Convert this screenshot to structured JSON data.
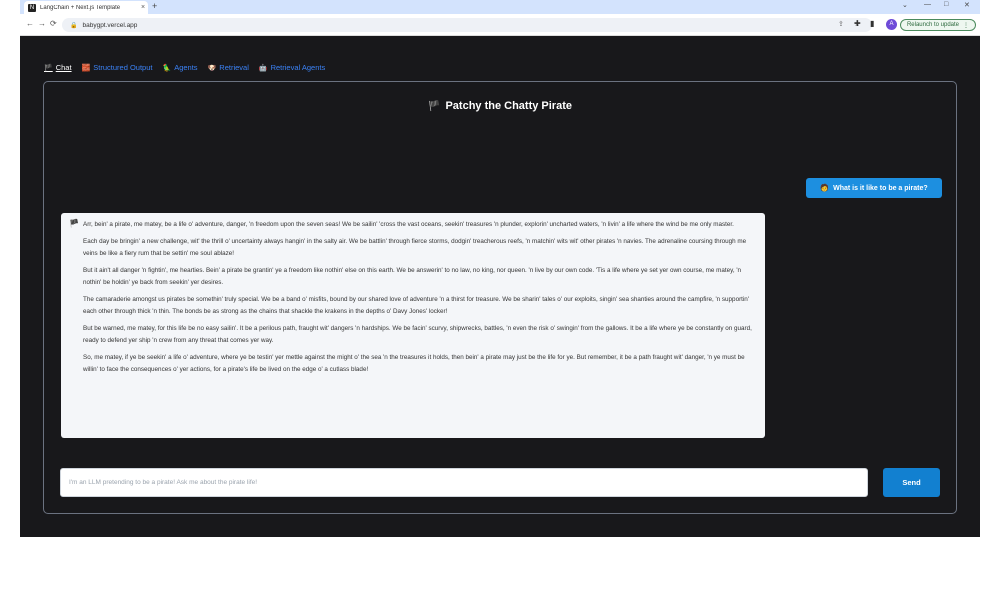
{
  "browser": {
    "tab_title": "LangChain + Next.js Template",
    "tab_favicon": "N",
    "url": "babygpt.vercel.app",
    "relaunch_label": "Relaunch to update",
    "avatar_initial": "A"
  },
  "nav": {
    "items": [
      {
        "icon": "chat-icon",
        "glyph": "🏴",
        "label": "Chat"
      },
      {
        "icon": "structured-output-icon",
        "glyph": "🧱",
        "label": "Structured Output"
      },
      {
        "icon": "agents-icon",
        "glyph": "🦜",
        "label": "Agents"
      },
      {
        "icon": "retrieval-icon",
        "glyph": "🐶",
        "label": "Retrieval"
      },
      {
        "icon": "retrieval-agents-icon",
        "glyph": "🤖",
        "label": "Retrieval Agents"
      }
    ]
  },
  "chat": {
    "title": "Patchy the Chatty Pirate",
    "title_icon": "🏴",
    "user_message": {
      "icon": "🧑",
      "text": "What is it like to be a pirate?"
    },
    "ai_message": {
      "icon": "🏴",
      "paragraphs": [
        "Arr, bein' a pirate, me matey, be a life o' adventure, danger, 'n freedom upon the seven seas! We be sailin' 'cross the vast oceans, seekin' treasures 'n plunder, explorin' uncharted waters, 'n livin' a life where the wind be me only master.",
        "Each day be bringin' a new challenge, wit' the thrill o' uncertainty always hangin' in the salty air. We be battlin' through fierce storms, dodgin' treacherous reefs, 'n matchin' wits wit' other pirates 'n navies. The adrenaline coursing through me veins be like a fiery rum that be settin' me soul ablaze!",
        "But it ain't all danger 'n fightin', me hearties. Bein' a pirate be grantin' ye a freedom like nothin' else on this earth. We be answerin' to no law, no king, nor queen. 'n live by our own code. 'Tis a life where ye set yer own course, me matey, 'n nothin' be holdin' ye back from seekin' yer desires.",
        "The camaraderie amongst us pirates be somethin' truly special. We be a band o' misfits, bound by our shared love of adventure 'n a thirst for treasure. We be sharin' tales o' our exploits, singin' sea shanties around the campfire, 'n supportin' each other through thick 'n thin. The bonds be as strong as the chains that shackle the krakens in the depths o' Davy Jones' locker!",
        "But be warned, me matey, for this life be no easy sailin'. It be a perilous path, fraught wit' dangers 'n hardships. We be facin' scurvy, shipwrecks, battles, 'n even the risk o' swingin' from the gallows. It be a life where ye be constantly on guard, ready to defend yer ship 'n crew from any threat that comes yer way.",
        "So, me matey, if ye be seekin' a life o' adventure, where ye be testin' yer mettle against the might o' the sea 'n the treasures it holds, then bein' a pirate may just be the life for ye. But remember, it be a path fraught wit' danger, 'n ye must be willin' to face the consequences o' yer actions, for a pirate's life be lived on the edge o' a cutlass blade!"
      ]
    },
    "input_placeholder": "I'm an LLM pretending to be a pirate! Ask me about the pirate life!",
    "send_label": "Send"
  }
}
